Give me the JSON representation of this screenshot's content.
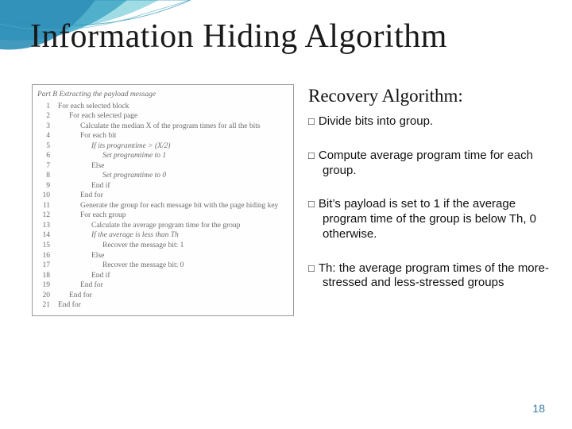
{
  "decor": {
    "wave_colors": [
      "#2f8fb8",
      "#42a8c8",
      "#8ed6df",
      "#bce8e8"
    ]
  },
  "title": "Information Hiding Algorithm",
  "left": {
    "heading": "Part B    Extracting the payload message",
    "lines": [
      {
        "n": "1",
        "indent": 0,
        "text": "For each selected block",
        "ital": false
      },
      {
        "n": "2",
        "indent": 1,
        "text": "For each selected page",
        "ital": false
      },
      {
        "n": "3",
        "indent": 2,
        "text": "Calculate the median  X  of the program times for all the bits",
        "ital": false
      },
      {
        "n": "4",
        "indent": 2,
        "text": "For each bit",
        "ital": false
      },
      {
        "n": "5",
        "indent": 3,
        "text": "If its programtime > (X/2)",
        "ital": true
      },
      {
        "n": "6",
        "indent": 4,
        "text": "Set programtime to 1",
        "ital": true
      },
      {
        "n": "7",
        "indent": 3,
        "text": "Else",
        "ital": false
      },
      {
        "n": "8",
        "indent": 4,
        "text": "Set programtime to 0",
        "ital": true
      },
      {
        "n": "9",
        "indent": 3,
        "text": "End if",
        "ital": false
      },
      {
        "n": "10",
        "indent": 2,
        "text": "End for",
        "ital": false
      },
      {
        "n": "11",
        "indent": 2,
        "text": "Generate the group for each message bit with the page hiding key",
        "ital": false
      },
      {
        "n": "12",
        "indent": 2,
        "text": "For each group",
        "ital": false
      },
      {
        "n": "13",
        "indent": 3,
        "text": "Calculate the average program time for the group",
        "ital": false
      },
      {
        "n": "14",
        "indent": 3,
        "text": "If the average is less than  Th",
        "ital": true
      },
      {
        "n": "15",
        "indent": 4,
        "text": "Recover the message bit: 1",
        "ital": false
      },
      {
        "n": "16",
        "indent": 3,
        "text": "Else",
        "ital": false
      },
      {
        "n": "17",
        "indent": 4,
        "text": "Recover the message bit: 0",
        "ital": false
      },
      {
        "n": "18",
        "indent": 3,
        "text": "End if",
        "ital": false
      },
      {
        "n": "19",
        "indent": 2,
        "text": "End for",
        "ital": false
      },
      {
        "n": "20",
        "indent": 1,
        "text": "End for",
        "ital": false
      },
      {
        "n": "21",
        "indent": 0,
        "text": "End for",
        "ital": false
      }
    ]
  },
  "right": {
    "subheading": "Recovery Algorithm:",
    "bullets": [
      "Divide bits into group.",
      "Compute average program time for each group.",
      "Bit’s payload is set to 1 if  the average program time of the group is below Th, 0 otherwise.",
      "Th: the average program times of the more-stressed and less-stressed groups"
    ]
  },
  "page_number": "18"
}
